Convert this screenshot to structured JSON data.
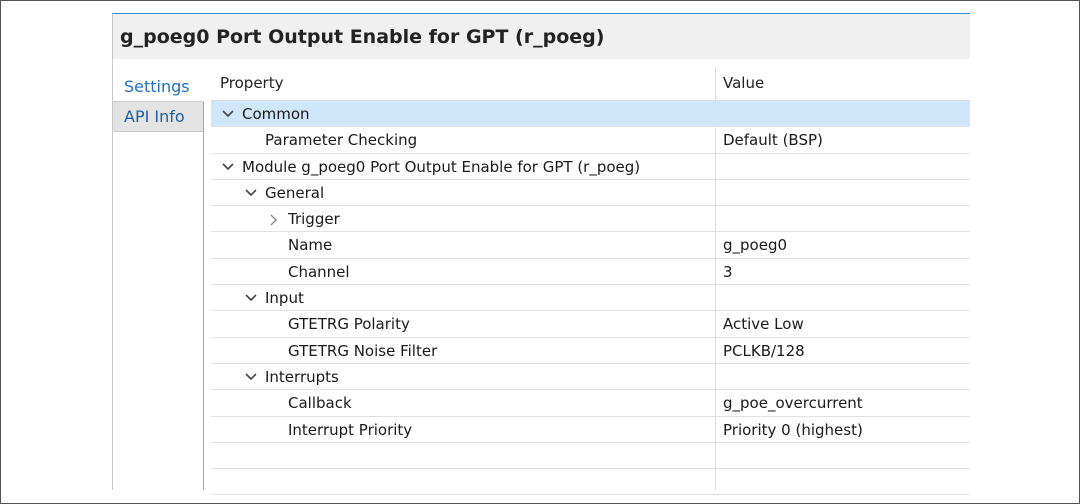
{
  "title": "g_poeg0 Port Output Enable for GPT (r_poeg)",
  "tabs": [
    {
      "label": "Settings",
      "active": true
    },
    {
      "label": "API Info",
      "active": false
    }
  ],
  "columns": {
    "property": "Property",
    "value": "Value"
  },
  "rows": [
    {
      "level": 0,
      "toggle": "expanded",
      "property": "Common",
      "value": "",
      "selected": true
    },
    {
      "level": 1,
      "toggle": "none",
      "property": "Parameter Checking",
      "value": "Default (BSP)"
    },
    {
      "level": 0,
      "toggle": "expanded",
      "property": "Module g_poeg0 Port Output Enable for GPT (r_poeg)",
      "value": ""
    },
    {
      "level": 1,
      "toggle": "expanded",
      "property": "General",
      "value": ""
    },
    {
      "level": 2,
      "toggle": "collapsed",
      "property": "Trigger",
      "value": ""
    },
    {
      "level": 2,
      "toggle": "none",
      "property": "Name",
      "value": "g_poeg0"
    },
    {
      "level": 2,
      "toggle": "none",
      "property": "Channel",
      "value": "3"
    },
    {
      "level": 1,
      "toggle": "expanded",
      "property": "Input",
      "value": ""
    },
    {
      "level": 2,
      "toggle": "none",
      "property": "GTETRG Polarity",
      "value": "Active Low"
    },
    {
      "level": 2,
      "toggle": "none",
      "property": "GTETRG Noise Filter",
      "value": "PCLKB/128"
    },
    {
      "level": 1,
      "toggle": "expanded",
      "property": "Interrupts",
      "value": ""
    },
    {
      "level": 2,
      "toggle": "none",
      "property": "Callback",
      "value": "g_poe_overcurrent"
    },
    {
      "level": 2,
      "toggle": "none",
      "property": "Interrupt Priority",
      "value": "Priority 0 (highest)"
    },
    {
      "level": 0,
      "toggle": "none",
      "property": "",
      "value": ""
    },
    {
      "level": 0,
      "toggle": "none",
      "property": "",
      "value": ""
    }
  ],
  "colors": {
    "selected_row": "#cfe6fb",
    "tab_text": "#1f6fbf",
    "title_bar": "#f0f0f0"
  }
}
